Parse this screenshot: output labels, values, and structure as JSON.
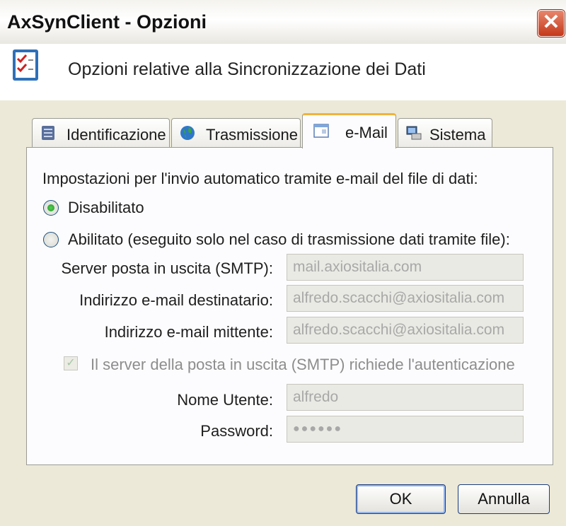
{
  "window": {
    "title": "AxSynClient - Opzioni"
  },
  "header": {
    "title": "Opzioni relative alla Sincronizzazione dei Dati"
  },
  "tabs": [
    {
      "label": "Identificazione",
      "icon": "database-icon"
    },
    {
      "label": "Trasmissione",
      "icon": "globe-icon"
    },
    {
      "label": "e-Mail",
      "icon": "mail-window-icon",
      "active": true
    },
    {
      "label": "Sistema",
      "icon": "computer-icon"
    }
  ],
  "email": {
    "intro": "Impostazioni per l'invio automatico tramite e-mail del file di dati:",
    "disabled_label": "Disabilitato",
    "enabled_label": "Abilitato (eseguito solo nel caso di trasmissione dati tramite file):",
    "selected": "Disabilitato",
    "smtp_label": "Server posta in uscita (SMTP):",
    "smtp_value": "mail.axiositalia.com",
    "dest_label": "Indirizzo e-mail destinatario:",
    "dest_value": "alfredo.scacchi@axiositalia.com",
    "sender_label": "Indirizzo e-mail mittente:",
    "sender_value": "alfredo.scacchi@axiositalia.com",
    "auth_label": "Il server della posta in uscita (SMTP) richiede l'autenticazione",
    "auth_checked": true,
    "user_label": "Nome Utente:",
    "user_value": "alfredo",
    "password_label": "Password:",
    "password_value": "●●●●●●"
  },
  "buttons": {
    "ok": "OK",
    "cancel": "Annulla"
  },
  "colors": {
    "active_tab_accent": "#f0b33a",
    "close_button": "#c4381a",
    "radio_selected": "#219621"
  }
}
